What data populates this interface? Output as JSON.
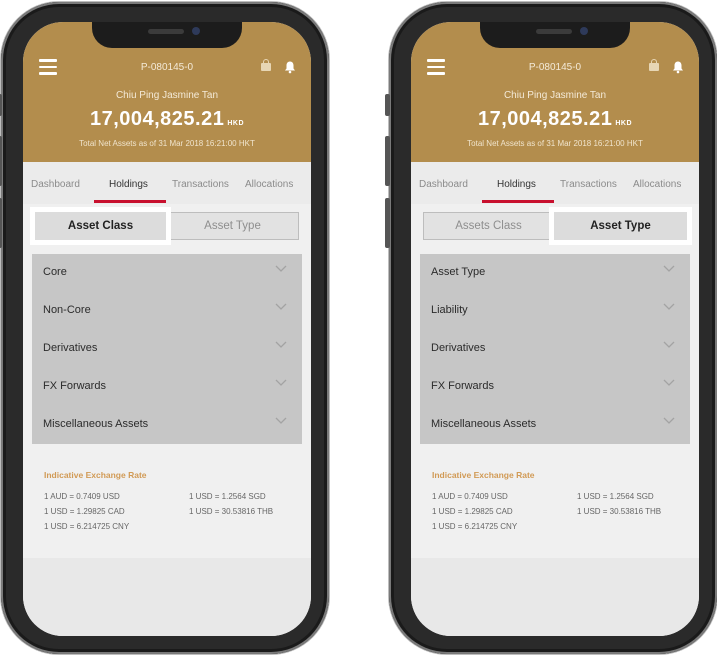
{
  "phones": [
    {
      "account_no": "P-080145-0",
      "client_name": "Chiu Ping Jasmine Tan",
      "net_assets": "17,004,825.21",
      "currency": "HKD",
      "as_of": "Total Net Assets as of 31 Mar 2018 16:21:00 HKT",
      "tabs": [
        "Dashboard",
        "Holdings",
        "Transactions",
        "Allocations"
      ],
      "active_tab": "Holdings",
      "toggle": {
        "left": "Asset Class",
        "right": "Asset Type",
        "selected": "left"
      },
      "rows": [
        "Core",
        "Non-Core",
        "Derivatives",
        "FX Forwards",
        "Miscellaneous Assets"
      ],
      "fx": {
        "title": "Indicative Exchange Rate",
        "col1": [
          "1 AUD = 0.7409 USD",
          "1 USD = 1.29825 CAD",
          "1 USD = 6.214725 CNY"
        ],
        "col2": [
          "1 USD = 1.2564 SGD",
          "1 USD = 30.53816 THB"
        ]
      }
    },
    {
      "account_no": "P-080145-0",
      "client_name": "Chiu Ping Jasmine Tan",
      "net_assets": "17,004,825.21",
      "currency": "HKD",
      "as_of": "Total Net Assets as of 31 Mar 2018 16:21:00 HKT",
      "tabs": [
        "Dashboard",
        "Holdings",
        "Transactions",
        "Allocations"
      ],
      "active_tab": "Holdings",
      "toggle": {
        "left": "Assets Class",
        "right": "Asset Type",
        "selected": "right"
      },
      "rows": [
        "Asset Type",
        "Liability",
        "Derivatives",
        "FX Forwards",
        "Miscellaneous Assets"
      ],
      "fx": {
        "title": "Indicative Exchange Rate",
        "col1": [
          "1 AUD = 0.7409 USD",
          "1 USD = 1.29825 CAD",
          "1 USD = 6.214725 CNY"
        ],
        "col2": [
          "1 USD = 1.2564 SGD",
          "1 USD = 30.53816 THB"
        ]
      }
    }
  ],
  "colors": {
    "header": "#b38d4d",
    "active_underline": "#c8102e",
    "fx_title": "#d19a55",
    "list_bg": "#c6c6c6"
  },
  "icons": [
    "menu-icon",
    "lock-icon",
    "bell-icon",
    "chevron-down-icon"
  ]
}
